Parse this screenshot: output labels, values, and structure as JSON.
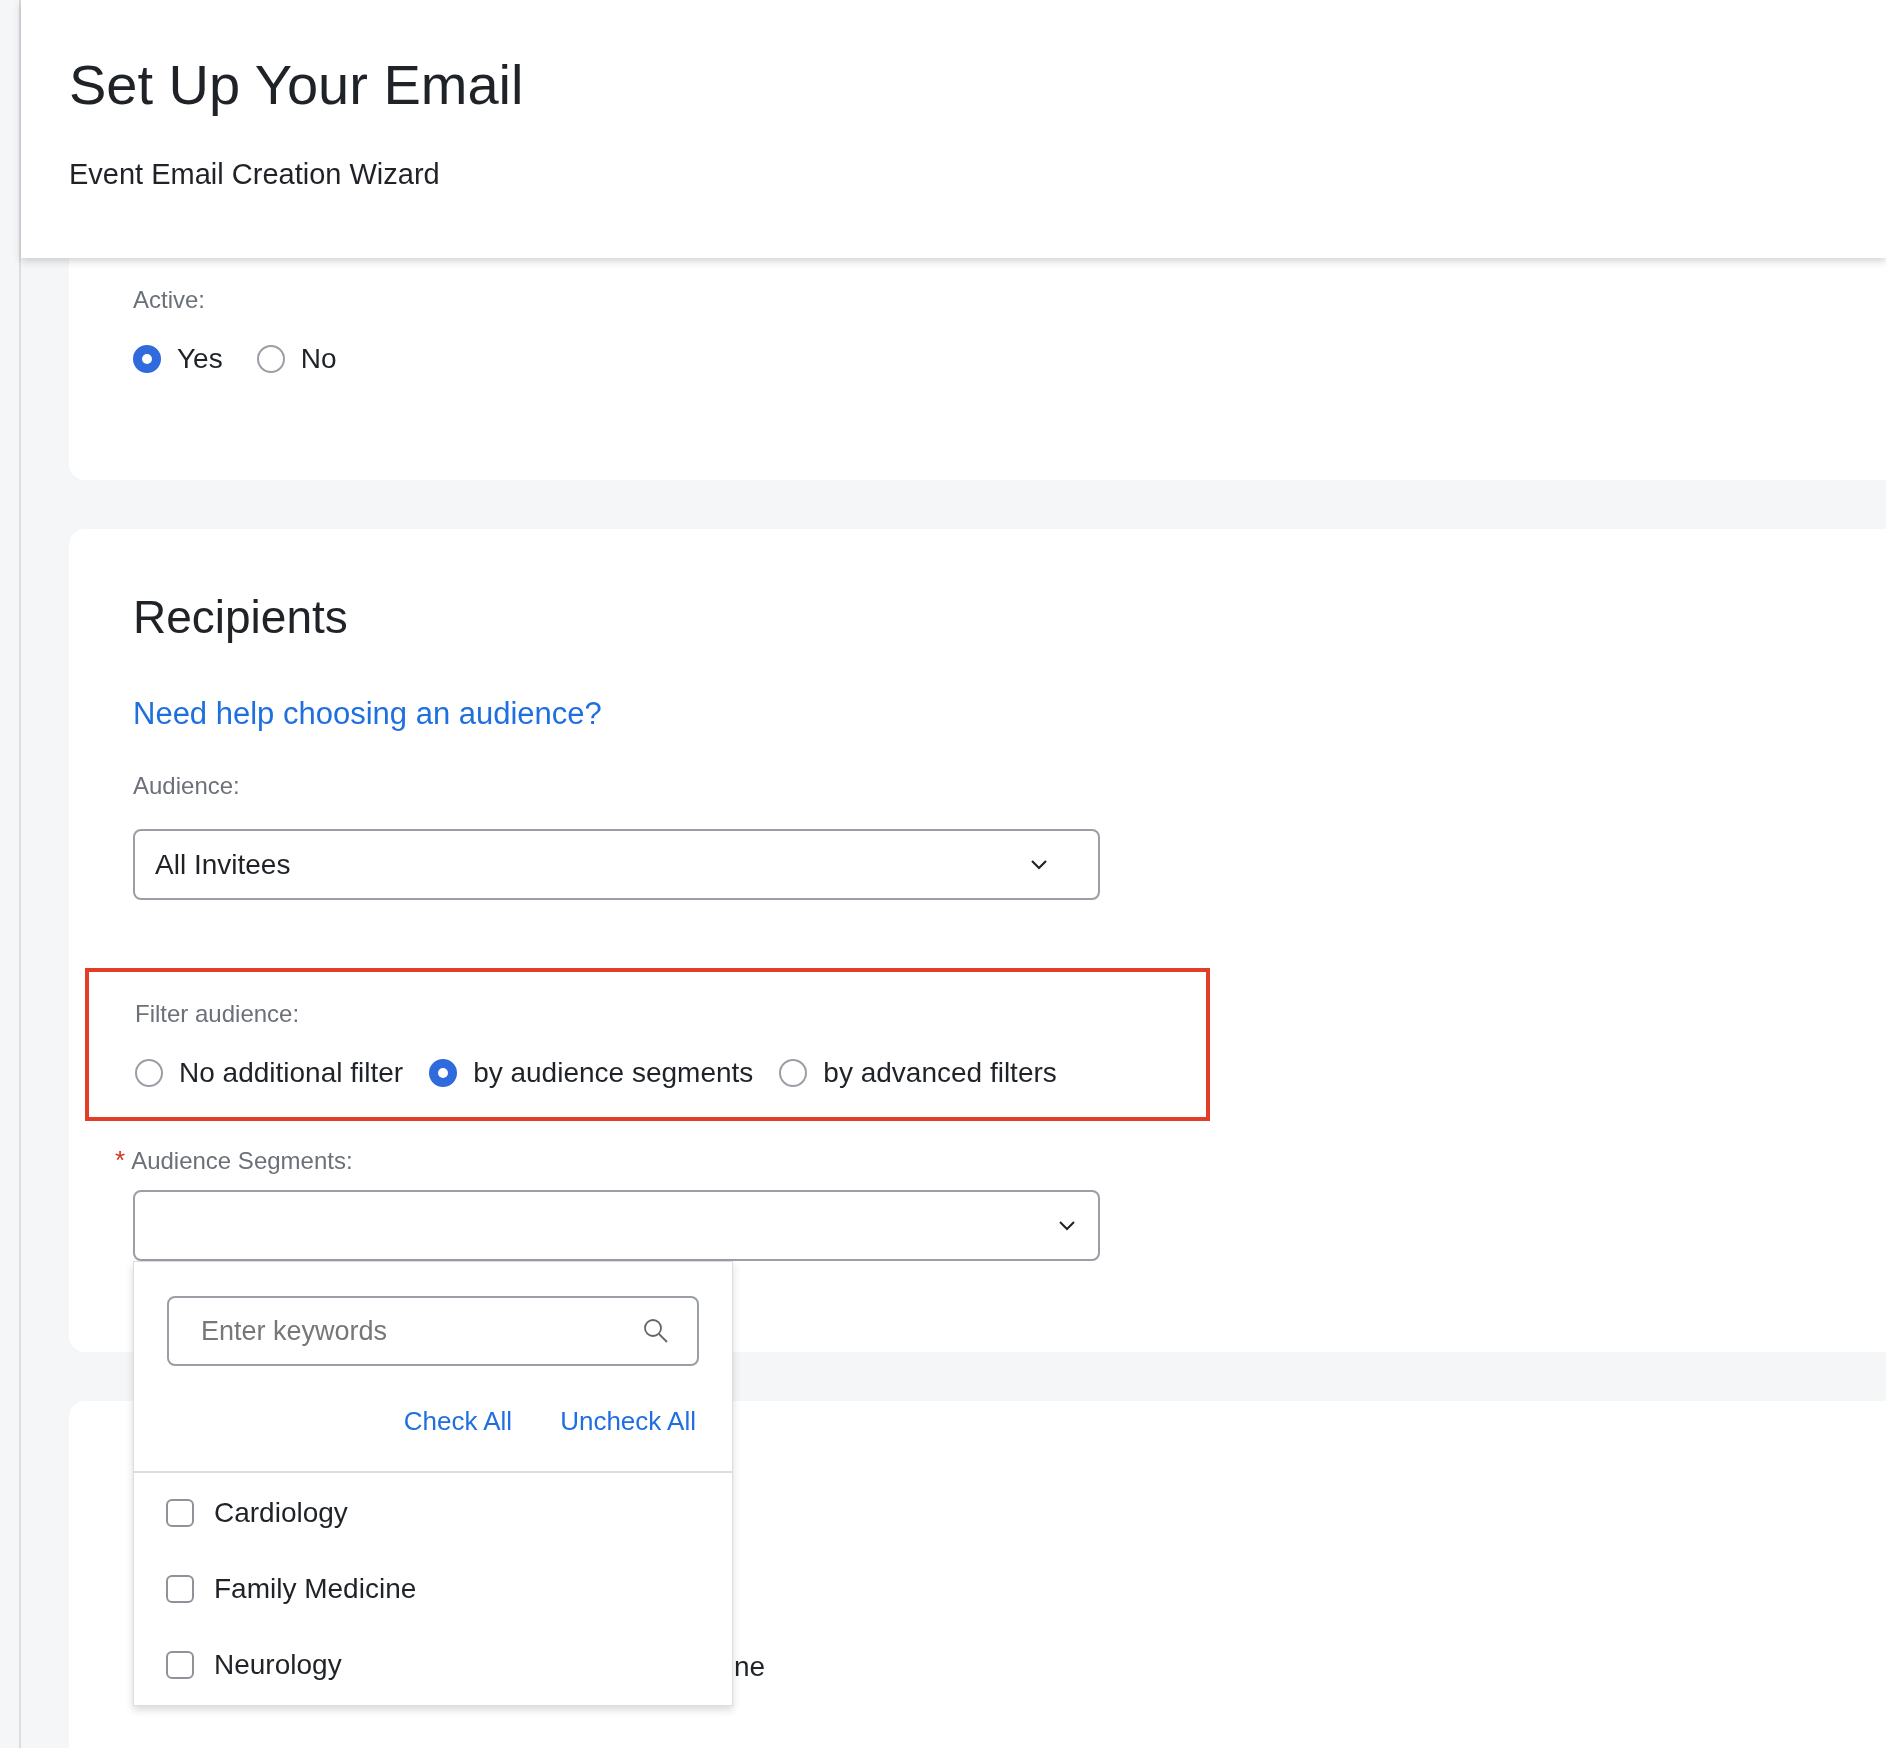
{
  "header": {
    "title": "Set Up Your Email",
    "subtitle": "Event Email Creation Wizard"
  },
  "active": {
    "label": "Active:",
    "options": [
      {
        "label": "Yes",
        "selected": true
      },
      {
        "label": "No",
        "selected": false
      }
    ]
  },
  "recipients": {
    "heading": "Recipients",
    "help_link": "Need help choosing an audience?",
    "audience": {
      "label": "Audience:",
      "value": "All Invitees"
    },
    "filter": {
      "label": "Filter audience:",
      "highlighted": true,
      "options": [
        {
          "label": "No additional filter",
          "selected": false
        },
        {
          "label": "by audience segments",
          "selected": true
        },
        {
          "label": "by advanced filters",
          "selected": false
        }
      ]
    },
    "segments": {
      "label": "Audience Segments:",
      "required_mark": "*",
      "expanded": true
    }
  },
  "segment_dropdown": {
    "search": {
      "placeholder": "Enter keywords"
    },
    "actions": [
      "Check All",
      "Uncheck All"
    ],
    "items": [
      {
        "label": "Cardiology",
        "checked": false
      },
      {
        "label": "Family Medicine",
        "checked": false
      },
      {
        "label": "Neurology",
        "checked": false
      }
    ]
  },
  "next_card": {
    "partial_text": "ne"
  }
}
